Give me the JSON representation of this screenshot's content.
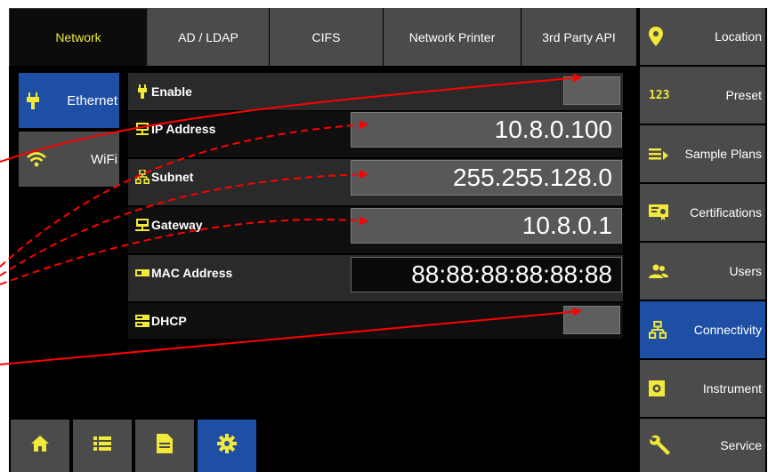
{
  "tabs": [
    {
      "label": "Network",
      "active": true
    },
    {
      "label": "AD / LDAP",
      "active": false
    },
    {
      "label": "CIFS",
      "active": false
    },
    {
      "label": "Network Printer",
      "active": false
    },
    {
      "label": "3rd Party API",
      "active": false
    }
  ],
  "subtabs": [
    {
      "label": "Ethernet",
      "active": true,
      "icon": "ethernet-plug-icon"
    },
    {
      "label": "WiFi",
      "active": false,
      "icon": "wifi-icon"
    }
  ],
  "ethernet": {
    "enable": {
      "label": "Enable",
      "icon": "plug-icon"
    },
    "ip_address": {
      "label": "IP Address",
      "value": "10.8.0.100",
      "icon": "monitor-network-icon"
    },
    "subnet": {
      "label": "Subnet",
      "value": "255.255.128.0",
      "icon": "network-tree-icon"
    },
    "gateway": {
      "label": "Gateway",
      "value": "10.8.0.1",
      "icon": "gateway-icon"
    },
    "mac_address": {
      "label": "MAC Address",
      "value": "88:88:88:88:88:88",
      "icon": "network-card-icon"
    },
    "dhcp": {
      "label": "DHCP",
      "icon": "server-icon"
    }
  },
  "nav": [
    {
      "label": "Location",
      "icon": "location-pin-icon",
      "active": false
    },
    {
      "label": "Preset",
      "icon": "preset-123-icon",
      "active": false
    },
    {
      "label": "Sample Plans",
      "icon": "list-arrow-icon",
      "active": false
    },
    {
      "label": "Certifications",
      "icon": "certificate-icon",
      "active": false
    },
    {
      "label": "Users",
      "icon": "users-icon",
      "active": false
    },
    {
      "label": "Connectivity",
      "icon": "network-tree-icon",
      "active": true
    },
    {
      "label": "Instrument",
      "icon": "instrument-icon",
      "active": false
    },
    {
      "label": "Service",
      "icon": "wrench-icon",
      "active": false
    }
  ],
  "bottom_bar": [
    {
      "icon": "home-icon",
      "active": false
    },
    {
      "icon": "list-icon",
      "active": false
    },
    {
      "icon": "document-icon",
      "active": false
    },
    {
      "icon": "gear-icon",
      "active": true
    }
  ],
  "colors": {
    "accent_yellow": "#f2e93a",
    "active_blue": "#1f4fa4",
    "button_gray": "#4b4b4b",
    "annotation_red": "#ff0000"
  }
}
